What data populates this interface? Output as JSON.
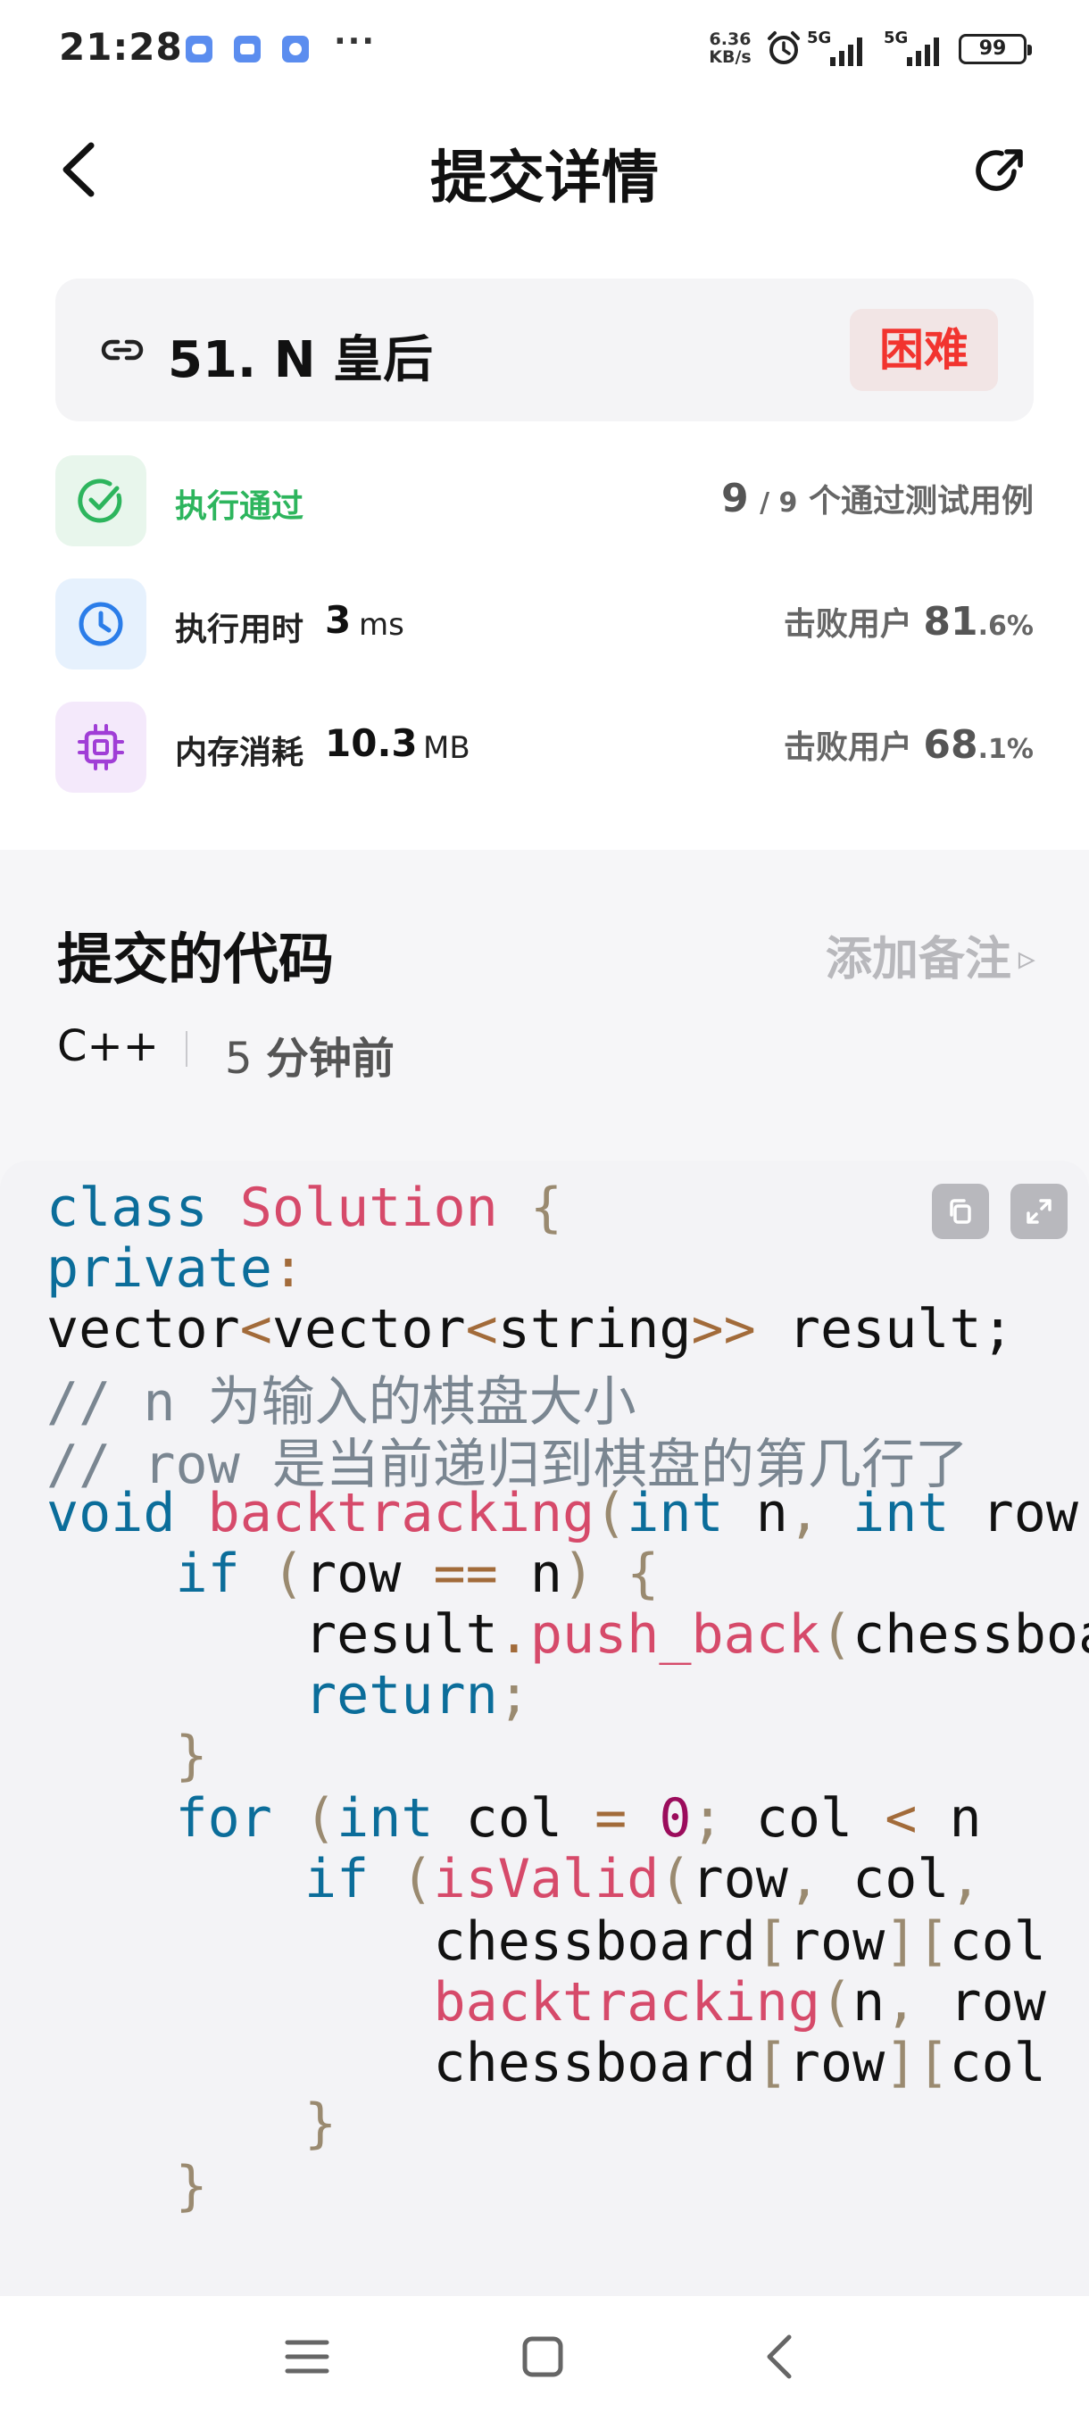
{
  "status_bar": {
    "time": "21:28",
    "more": "···",
    "net_speed_value": "6.36",
    "net_speed_unit": "KB/s",
    "sim1": "5G",
    "sim2": "5G",
    "battery": "99"
  },
  "header": {
    "title": "提交详情",
    "back_icon": "chevron-left-icon",
    "share_icon": "share-arrow-icon"
  },
  "problem": {
    "title": "51. N 皇后",
    "difficulty": "困难",
    "difficulty_color": "#f2342f"
  },
  "result": {
    "status": "执行通过",
    "status_color": "#2db55d",
    "passed": "9",
    "total": "/ 9",
    "passed_suffix": "个通过测试用例"
  },
  "runtime": {
    "label": "执行用时",
    "value": "3",
    "unit": "ms",
    "beat_label": "击败用户",
    "beat_int": "81",
    "beat_dec": ".6%"
  },
  "memory": {
    "label": "内存消耗",
    "value": "10.3",
    "unit": "MB",
    "beat_label": "击败用户",
    "beat_int": "68",
    "beat_dec": ".1%"
  },
  "code_section": {
    "title": "提交的代码",
    "add_note": "添加备注",
    "add_note_icon": "▹",
    "language": "C++",
    "time_num": "5",
    "time_text": "分钟前"
  },
  "code": {
    "lines": [
      [
        {
          "c": "kw",
          "t": "class"
        },
        {
          "c": "pl",
          "t": " "
        },
        {
          "c": "fn",
          "t": "Solution"
        },
        {
          "c": "pl",
          "t": " "
        },
        {
          "c": "pu",
          "t": "{"
        }
      ],
      [
        {
          "c": "kw",
          "t": "private"
        },
        {
          "c": "op",
          "t": ":"
        }
      ],
      [
        {
          "c": "pl",
          "t": "vector"
        },
        {
          "c": "op",
          "t": "<"
        },
        {
          "c": "pl",
          "t": "vector"
        },
        {
          "c": "op",
          "t": "<"
        },
        {
          "c": "pl",
          "t": "string"
        },
        {
          "c": "op",
          "t": ">>"
        },
        {
          "c": "pl",
          "t": " result;"
        }
      ],
      [
        {
          "c": "cm",
          "t": "// n 为输入的棋盘大小"
        }
      ],
      [
        {
          "c": "cm",
          "t": "// row 是当前递归到棋盘的第几行了"
        }
      ],
      [
        {
          "c": "kw",
          "t": "void"
        },
        {
          "c": "pl",
          "t": " "
        },
        {
          "c": "fn",
          "t": "backtracking"
        },
        {
          "c": "pu",
          "t": "("
        },
        {
          "c": "ty",
          "t": "int"
        },
        {
          "c": "pl",
          "t": " n"
        },
        {
          "c": "pu",
          "t": ","
        },
        {
          "c": "pl",
          "t": " "
        },
        {
          "c": "ty",
          "t": "int"
        },
        {
          "c": "pl",
          "t": " row"
        }
      ],
      [
        {
          "c": "pl",
          "t": "    "
        },
        {
          "c": "kw",
          "t": "if"
        },
        {
          "c": "pl",
          "t": " "
        },
        {
          "c": "pu",
          "t": "("
        },
        {
          "c": "pl",
          "t": "row "
        },
        {
          "c": "op",
          "t": "=="
        },
        {
          "c": "pl",
          "t": " n"
        },
        {
          "c": "pu",
          "t": ")"
        },
        {
          "c": "pl",
          "t": " "
        },
        {
          "c": "pu",
          "t": "{"
        }
      ],
      [
        {
          "c": "pl",
          "t": "        result"
        },
        {
          "c": "op",
          "t": "."
        },
        {
          "c": "fn",
          "t": "push_back"
        },
        {
          "c": "pu",
          "t": "("
        },
        {
          "c": "pl",
          "t": "chessboard"
        }
      ],
      [
        {
          "c": "pl",
          "t": "        "
        },
        {
          "c": "kw",
          "t": "return"
        },
        {
          "c": "pu",
          "t": ";"
        }
      ],
      [
        {
          "c": "pl",
          "t": "    "
        },
        {
          "c": "pu",
          "t": "}"
        }
      ],
      [
        {
          "c": "pl",
          "t": "    "
        },
        {
          "c": "kw",
          "t": "for"
        },
        {
          "c": "pl",
          "t": " "
        },
        {
          "c": "pu",
          "t": "("
        },
        {
          "c": "ty",
          "t": "int"
        },
        {
          "c": "pl",
          "t": " col "
        },
        {
          "c": "op",
          "t": "="
        },
        {
          "c": "pl",
          "t": " "
        },
        {
          "c": "nu",
          "t": "0"
        },
        {
          "c": "pu",
          "t": ";"
        },
        {
          "c": "pl",
          "t": " col "
        },
        {
          "c": "op",
          "t": "<"
        },
        {
          "c": "pl",
          "t": " n"
        }
      ],
      [
        {
          "c": "pl",
          "t": "        "
        },
        {
          "c": "kw",
          "t": "if"
        },
        {
          "c": "pl",
          "t": " "
        },
        {
          "c": "pu",
          "t": "("
        },
        {
          "c": "fn",
          "t": "isValid"
        },
        {
          "c": "pu",
          "t": "("
        },
        {
          "c": "pl",
          "t": "row"
        },
        {
          "c": "pu",
          "t": ","
        },
        {
          "c": "pl",
          "t": " col"
        },
        {
          "c": "pu",
          "t": ","
        }
      ],
      [
        {
          "c": "pl",
          "t": "            chessboard"
        },
        {
          "c": "pu",
          "t": "["
        },
        {
          "c": "pl",
          "t": "row"
        },
        {
          "c": "pu",
          "t": "]["
        },
        {
          "c": "pl",
          "t": "col"
        }
      ],
      [
        {
          "c": "pl",
          "t": "            "
        },
        {
          "c": "fn",
          "t": "backtracking"
        },
        {
          "c": "pu",
          "t": "("
        },
        {
          "c": "pl",
          "t": "n"
        },
        {
          "c": "pu",
          "t": ","
        },
        {
          "c": "pl",
          "t": " row"
        }
      ],
      [
        {
          "c": "pl",
          "t": "            chessboard"
        },
        {
          "c": "pu",
          "t": "["
        },
        {
          "c": "pl",
          "t": "row"
        },
        {
          "c": "pu",
          "t": "]["
        },
        {
          "c": "pl",
          "t": "col"
        }
      ],
      [
        {
          "c": "pl",
          "t": "        "
        },
        {
          "c": "pu",
          "t": "}"
        }
      ],
      [
        {
          "c": "pl",
          "t": "    "
        },
        {
          "c": "pu",
          "t": "}"
        }
      ]
    ]
  },
  "nav_bar": {
    "menu_icon": "menu-lines-icon",
    "home_icon": "home-square-icon",
    "back_icon": "back-chevron-icon"
  }
}
